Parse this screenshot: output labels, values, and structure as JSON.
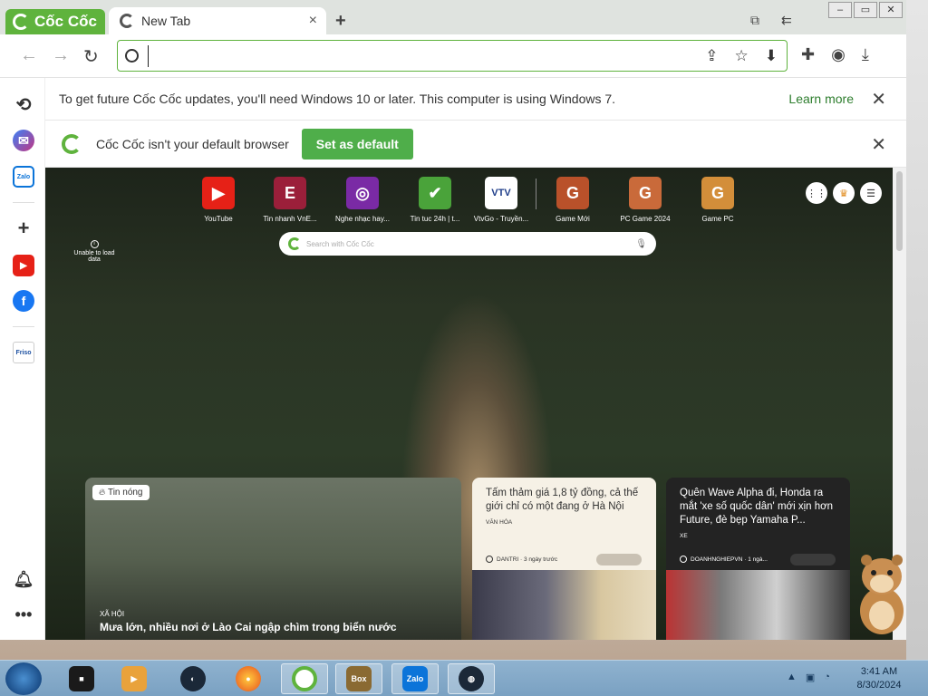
{
  "browser": {
    "brand": "Cốc Cốc",
    "tab": {
      "title": "New Tab",
      "close": "×"
    },
    "newtab": "+",
    "window_buttons": [
      "‒",
      "▭",
      "✕"
    ],
    "omnibox": {
      "value": "",
      "placeholder": ""
    }
  },
  "infobars": {
    "update": {
      "message": "To get future Cốc Cốc updates, you'll need Windows 10 or later. This computer is using Windows 7.",
      "link": "Learn more"
    },
    "default": {
      "message": "Cốc Cốc isn't your default browser",
      "button": "Set as default"
    }
  },
  "sidebar": {
    "items": [
      "history",
      "messenger",
      "zalo",
      "add",
      "youtube",
      "facebook",
      "friso",
      "notifications",
      "more"
    ],
    "zalo_label": "Zalo",
    "friso_label": "Friso"
  },
  "newtab": {
    "unable": "Unable to load data",
    "search_placeholder": "Search with Cốc Cốc",
    "speed_dials": [
      {
        "label": "YouTube",
        "icon": "▶",
        "color": "#e62117"
      },
      {
        "label": "Tin nhanh VnE...",
        "icon": "E",
        "color": "#9b1f3a"
      },
      {
        "label": "Nghe nhạc hay...",
        "icon": "◎",
        "color": "#7a2aa5"
      },
      {
        "label": "Tin tuc 24h | t...",
        "icon": "✔",
        "color": "#4aa33a"
      },
      {
        "label": "VtvGo - Truyền...",
        "icon": "VTV",
        "color": "#ffffff"
      },
      {
        "label": "Game Mới",
        "icon": "G",
        "color": "#b9512a"
      },
      {
        "label": "PC Game 2024",
        "icon": "G",
        "color": "#c96a3a"
      },
      {
        "label": "Game PC",
        "icon": "G",
        "color": "#d38e3a"
      }
    ],
    "news_big": {
      "badge": "Tin nóng",
      "category": "XÃ HỘI",
      "title": "Mưa lớn, nhiều nơi ở Lào Cai ngập chìm trong biển nước"
    },
    "news_cards": [
      {
        "title": "Tấm thảm giá 1,8 tỷ đồng, cả thế giới chỉ có một đang ở Hà Nội",
        "category": "VĂN HÓA",
        "source": "DANTRI · 3 ngày trước"
      },
      {
        "title": "Quên Wave Alpha đi, Honda ra mắt 'xe số quốc dân' mới xịn hơn Future, đè bẹp Yamaha P...",
        "category": "XE",
        "source": "DOANHNGHIEPVN · 1 ngà..."
      }
    ]
  },
  "taskbar": {
    "apps": [
      "start",
      "media",
      "player",
      "steam-dark",
      "firefox",
      "coccoc",
      "box",
      "zalo",
      "steam"
    ],
    "box_label": "Box",
    "zalo_label": "Zalo",
    "time": "3:41 AM",
    "date": "8/30/2024"
  },
  "colors": {
    "accent": "#5fb33d",
    "button": "#4fae4a"
  }
}
